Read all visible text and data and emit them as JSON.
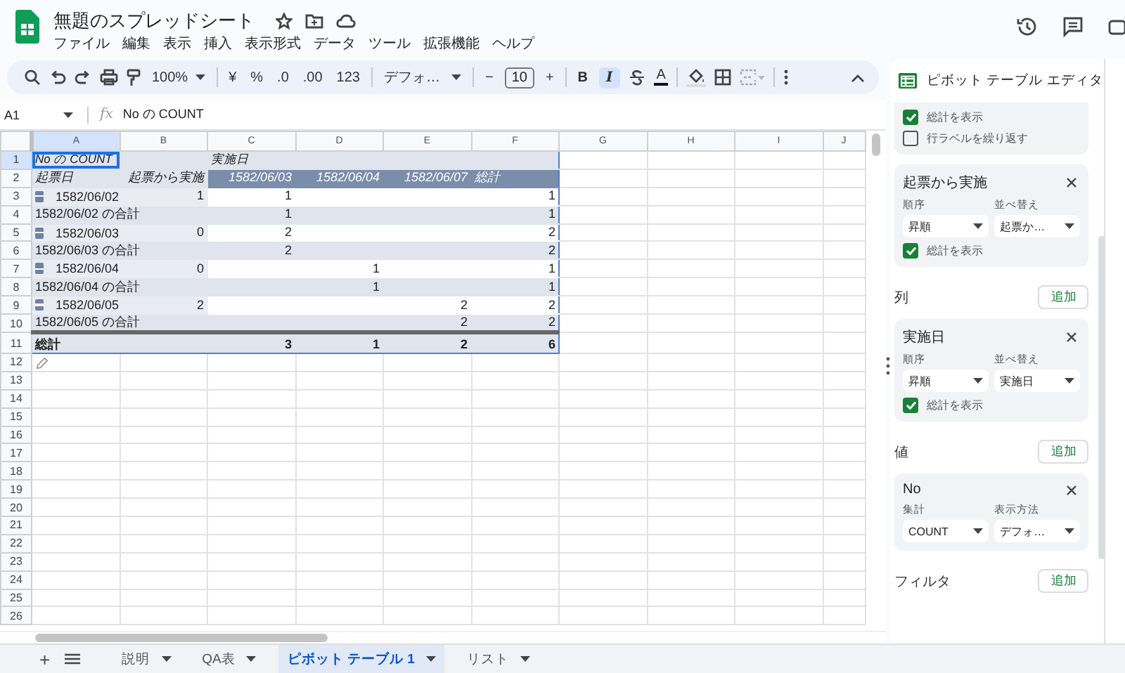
{
  "document": {
    "title": "無題のスプレッドシート"
  },
  "menu": [
    "ファイル",
    "編集",
    "表示",
    "挿入",
    "表示形式",
    "データ",
    "ツール",
    "拡張機能",
    "ヘルプ"
  ],
  "toolbar": {
    "zoom": "100%",
    "currency": "¥",
    "percent": "%",
    "decrease_decimals": ".0",
    "increase_decimals": ".00",
    "number_format": "123",
    "font": "デフォ…",
    "minus": "−",
    "font_size": "10",
    "plus": "+",
    "bold": {
      "label": "B",
      "on": false
    },
    "italic": {
      "label": "I",
      "on": true
    },
    "text_color": "A"
  },
  "formula_bar": {
    "name_box": "A1",
    "fx": "fx",
    "value": "No の COUNT"
  },
  "grid": {
    "columns": [
      {
        "label": "A",
        "selected": true
      },
      {
        "label": "B",
        "selected": false
      },
      {
        "label": "C",
        "selected": false
      },
      {
        "label": "D",
        "selected": false
      },
      {
        "label": "E",
        "selected": false
      },
      {
        "label": "F",
        "selected": false
      },
      {
        "label": "G",
        "selected": false
      },
      {
        "label": "H",
        "selected": false
      },
      {
        "label": "I",
        "selected": false
      },
      {
        "label": "J",
        "selected": false
      }
    ],
    "rows": [
      {
        "number": "1",
        "selected": true,
        "kind": "title",
        "cells": [
          "No の COUNT",
          null,
          "実施日",
          null,
          null,
          null
        ]
      },
      {
        "number": "2",
        "selected": false,
        "kind": "header",
        "cells": [
          "起票日",
          "起票から実施",
          "1582/06/03",
          "1582/06/04",
          "1582/06/07",
          "総計"
        ]
      },
      {
        "number": "3",
        "selected": false,
        "kind": "group",
        "expanded": true,
        "cells": [
          "1582/06/02",
          "1",
          "1",
          null,
          null,
          "1"
        ]
      },
      {
        "number": "4",
        "selected": false,
        "kind": "subtotal",
        "cells": [
          "1582/06/02 の合計",
          null,
          "1",
          null,
          null,
          "1"
        ]
      },
      {
        "number": "5",
        "selected": false,
        "kind": "group",
        "expanded": true,
        "cells": [
          "1582/06/03",
          "0",
          "2",
          null,
          null,
          "2"
        ]
      },
      {
        "number": "6",
        "selected": false,
        "kind": "subtotal",
        "cells": [
          "1582/06/03 の合計",
          null,
          "2",
          null,
          null,
          "2"
        ]
      },
      {
        "number": "7",
        "selected": false,
        "kind": "group",
        "expanded": true,
        "cells": [
          "1582/06/04",
          "0",
          null,
          "1",
          null,
          "1"
        ]
      },
      {
        "number": "8",
        "selected": false,
        "kind": "subtotal",
        "cells": [
          "1582/06/04 の合計",
          null,
          null,
          "1",
          null,
          "1"
        ]
      },
      {
        "number": "9",
        "selected": false,
        "kind": "group",
        "expanded": true,
        "cells": [
          "1582/06/05",
          "2",
          null,
          null,
          "2",
          "2"
        ]
      },
      {
        "number": "10",
        "selected": false,
        "kind": "subtotal",
        "cells": [
          "1582/06/05 の合計",
          null,
          null,
          null,
          "2",
          "2"
        ]
      },
      {
        "number": "11",
        "selected": false,
        "kind": "grand",
        "cells": [
          "総計",
          null,
          "3",
          "1",
          "2",
          "6"
        ]
      },
      {
        "number": "12",
        "selected": false,
        "kind": "blank"
      },
      {
        "number": "13",
        "selected": false,
        "kind": "blank"
      },
      {
        "number": "14",
        "selected": false,
        "kind": "blank"
      },
      {
        "number": "15",
        "selected": false,
        "kind": "blank"
      },
      {
        "number": "16",
        "selected": false,
        "kind": "blank"
      },
      {
        "number": "17",
        "selected": false,
        "kind": "blank"
      },
      {
        "number": "18",
        "selected": false,
        "kind": "blank"
      },
      {
        "number": "19",
        "selected": false,
        "kind": "blank"
      },
      {
        "number": "20",
        "selected": false,
        "kind": "blank"
      },
      {
        "number": "21",
        "selected": false,
        "kind": "blank"
      },
      {
        "number": "22",
        "selected": false,
        "kind": "blank"
      },
      {
        "number": "23",
        "selected": false,
        "kind": "blank"
      },
      {
        "number": "24",
        "selected": false,
        "kind": "blank"
      },
      {
        "number": "25",
        "selected": false,
        "kind": "blank"
      },
      {
        "number": "26",
        "selected": false,
        "kind": "blank"
      }
    ]
  },
  "panel": {
    "title": "ピボット テーブル エディタ",
    "items": [
      {
        "kind": "card",
        "checkboxes": [
          {
            "label": "総計を表示",
            "checked": true
          },
          {
            "label": "行ラベルを繰り返す",
            "checked": false
          }
        ]
      },
      {
        "kind": "card",
        "title": "起票から実施",
        "fields": [
          {
            "label": "順序",
            "value": "昇順"
          },
          {
            "label": "並べ替え",
            "value": "起票か…"
          }
        ],
        "checkboxes": [
          {
            "label": "総計を表示",
            "checked": true
          }
        ]
      },
      {
        "kind": "section",
        "title": "列",
        "button": "追加"
      },
      {
        "kind": "card",
        "title": "実施日",
        "fields": [
          {
            "label": "順序",
            "value": "昇順"
          },
          {
            "label": "並べ替え",
            "value": "実施日"
          }
        ],
        "checkboxes": [
          {
            "label": "総計を表示",
            "checked": true
          }
        ]
      },
      {
        "kind": "section",
        "title": "値",
        "button": "追加"
      },
      {
        "kind": "card",
        "title": "No",
        "fields": [
          {
            "label": "集計",
            "value": "COUNT"
          },
          {
            "label": "表示方法",
            "value": "デフォ…"
          }
        ]
      },
      {
        "kind": "section",
        "title": "フィルタ",
        "button": "追加"
      }
    ]
  },
  "sheet_tabs": {
    "add": "+",
    "tabs": [
      {
        "label": "説明",
        "selected": false
      },
      {
        "label": "QA表",
        "selected": false
      },
      {
        "label": "ピボット テーブル 1",
        "selected": true
      },
      {
        "label": "リスト",
        "selected": false
      }
    ]
  }
}
